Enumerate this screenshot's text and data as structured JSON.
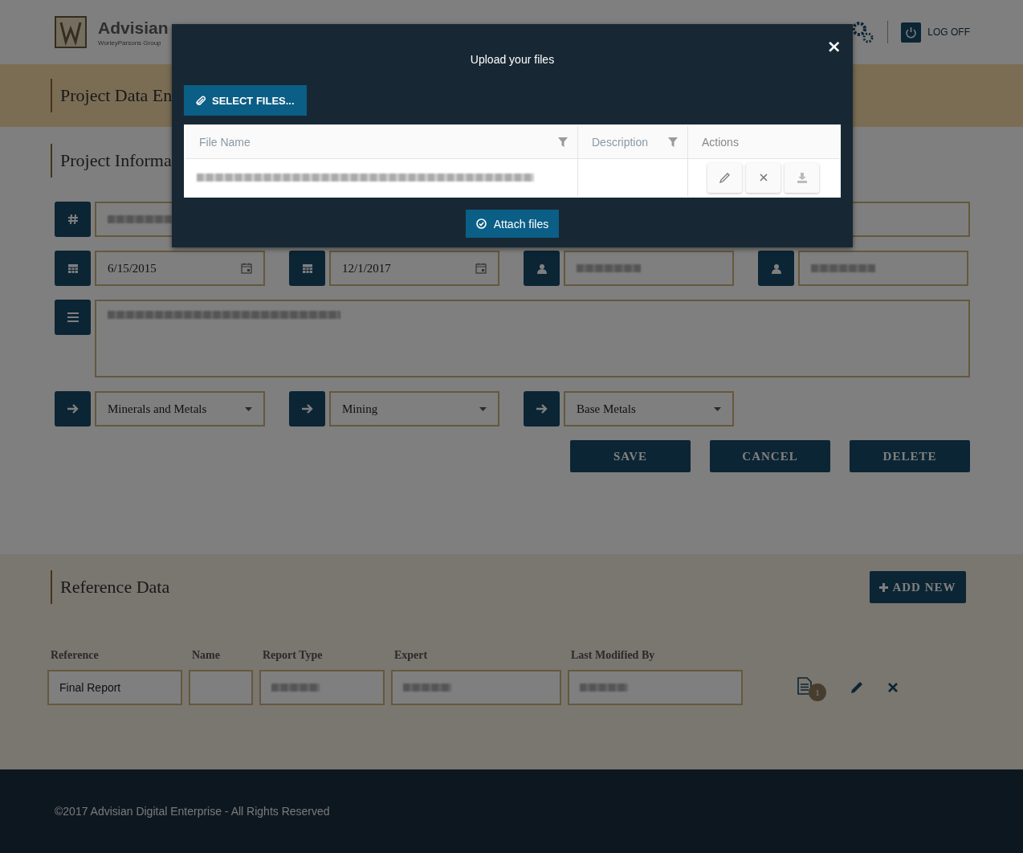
{
  "header": {
    "logo_text": "Advisian",
    "logo_subtitle": "WorleyParsons Group",
    "log_off": "LOG OFF"
  },
  "banner": {
    "title": "Project Data En"
  },
  "project_section": {
    "title": "Project Informa",
    "rows": [
      {
        "kind": "single",
        "fields": [
          {
            "kind": "number",
            "redacted": true
          }
        ]
      },
      {
        "kind": "quad",
        "fields": [
          {
            "kind": "date",
            "value": "6/15/2015"
          },
          {
            "kind": "date",
            "value": "12/1/2017"
          },
          {
            "kind": "person",
            "redacted": true
          },
          {
            "kind": "person",
            "redacted": true
          }
        ]
      },
      {
        "kind": "area",
        "fields": [
          {
            "kind": "textarea",
            "redacted": true
          }
        ]
      },
      {
        "kind": "quad",
        "fields": [
          {
            "kind": "select",
            "value": "Minerals and Metals"
          },
          {
            "kind": "select",
            "value": "Mining"
          },
          {
            "kind": "select",
            "value": "Base Metals"
          }
        ]
      }
    ],
    "buttons": [
      "SAVE",
      "CANCEL",
      "DELETE"
    ]
  },
  "reference_section": {
    "title": "Reference Data",
    "add_button": "ADD NEW",
    "columns": [
      "Reference",
      "Name",
      "Report Type",
      "Expert",
      "Last Modified By"
    ],
    "rows": [
      {
        "cells": [
          {
            "value": "Final Report"
          },
          {},
          {
            "redacted": true
          },
          {
            "redacted": true
          },
          {
            "redacted": true
          }
        ],
        "attachments": "1"
      }
    ]
  },
  "footer": {
    "text": "©2017 Advisian Digital Enterprise - All Rights Reserved"
  },
  "modal": {
    "title": "Upload your files",
    "close": "×",
    "select_button": "SELECT FILES...",
    "columns": [
      {
        "label": "File Name",
        "filter": true
      },
      {
        "label": "Description",
        "filter": true
      },
      {
        "label": "Actions",
        "filter": false
      }
    ],
    "files": [
      {
        "redacted": true
      }
    ],
    "attach_button": "Attach files"
  }
}
